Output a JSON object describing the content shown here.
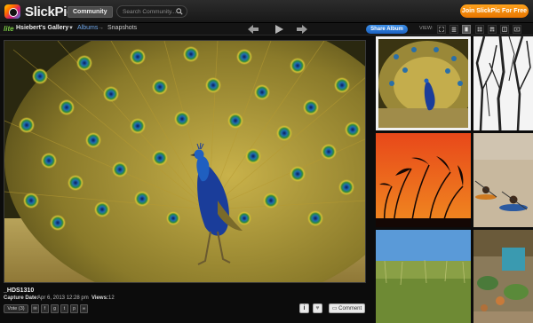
{
  "app": {
    "logo_text": "SlickPic"
  },
  "header": {
    "community_label": "Community",
    "search_placeholder": "Search Community...",
    "join_label": "Join SlickPic For Free"
  },
  "nav": {
    "lite_label": "lite",
    "gallery_name": "Hsiebert's Gallery",
    "breadcrumb_albums": "Albums",
    "breadcrumb_arrow": "→",
    "breadcrumb_current": "Snapshots",
    "share_label": "Share Album",
    "view_label": "VIEW:"
  },
  "photo": {
    "title": "_HDS1310",
    "capture_label": "Capture Date:",
    "capture_value": "Apr 6, 2013 12:28 pm",
    "views_label": "Views:",
    "views_value": "12",
    "vote_label": "Vote (3)",
    "info_label": "i",
    "comment_label": "Comment"
  },
  "thumbnails": [
    "peacock",
    "bare-trees",
    "reeds-sunset",
    "kayakers",
    "grass-sky",
    "garden-cats"
  ],
  "colors": {
    "accent_orange": "#f08a0c",
    "accent_blue": "#2a7bd8",
    "crumb_blue": "#6fa6e8"
  }
}
